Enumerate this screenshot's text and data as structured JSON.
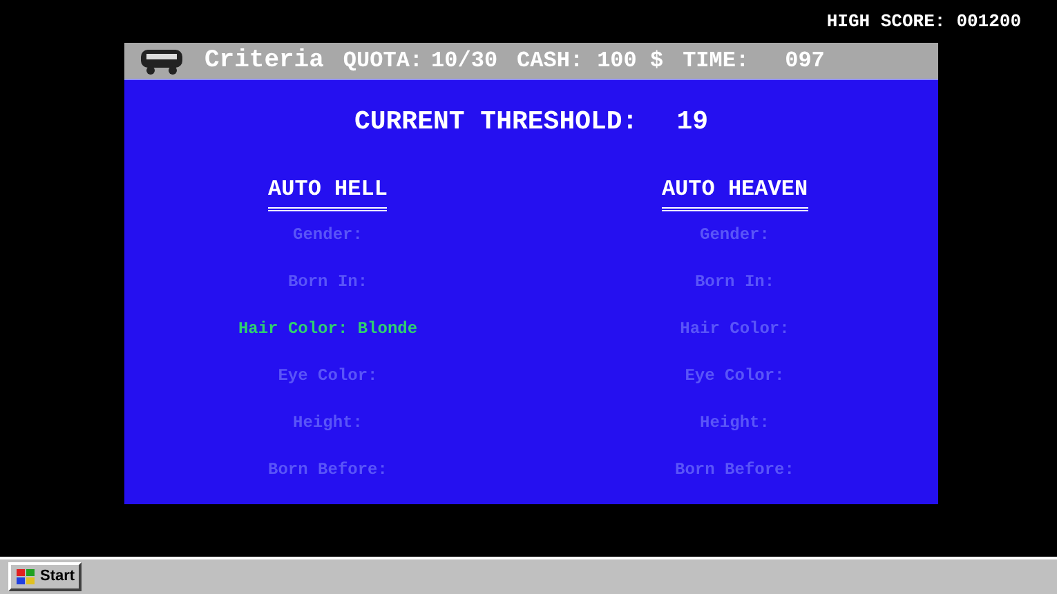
{
  "high_score": {
    "label": "HIGH SCORE:",
    "value": "001200"
  },
  "title_bar": {
    "title": "Criteria",
    "quota_label": "QUOTA:",
    "quota": "10/30",
    "cash_label": "CASH:",
    "cash": "100 $",
    "time_label": "TIME:",
    "time": "097"
  },
  "threshold": {
    "label": "CURRENT THRESHOLD:",
    "value": "19"
  },
  "columns": [
    {
      "heading": "AUTO HELL",
      "criteria": [
        {
          "text": "Gender:",
          "set": false
        },
        {
          "text": "Born In:",
          "set": false
        },
        {
          "text": "Hair Color: Blonde",
          "set": true
        },
        {
          "text": "Eye Color:",
          "set": false
        },
        {
          "text": "Height:",
          "set": false
        },
        {
          "text": "Born Before:",
          "set": false
        }
      ]
    },
    {
      "heading": "AUTO HEAVEN",
      "criteria": [
        {
          "text": "Gender:",
          "set": false
        },
        {
          "text": "Born In:",
          "set": false
        },
        {
          "text": "Hair Color:",
          "set": false
        },
        {
          "text": "Eye Color:",
          "set": false
        },
        {
          "text": "Height:",
          "set": false
        },
        {
          "text": "Born Before:",
          "set": false
        }
      ]
    }
  ],
  "taskbar": {
    "start_label": "Start"
  }
}
